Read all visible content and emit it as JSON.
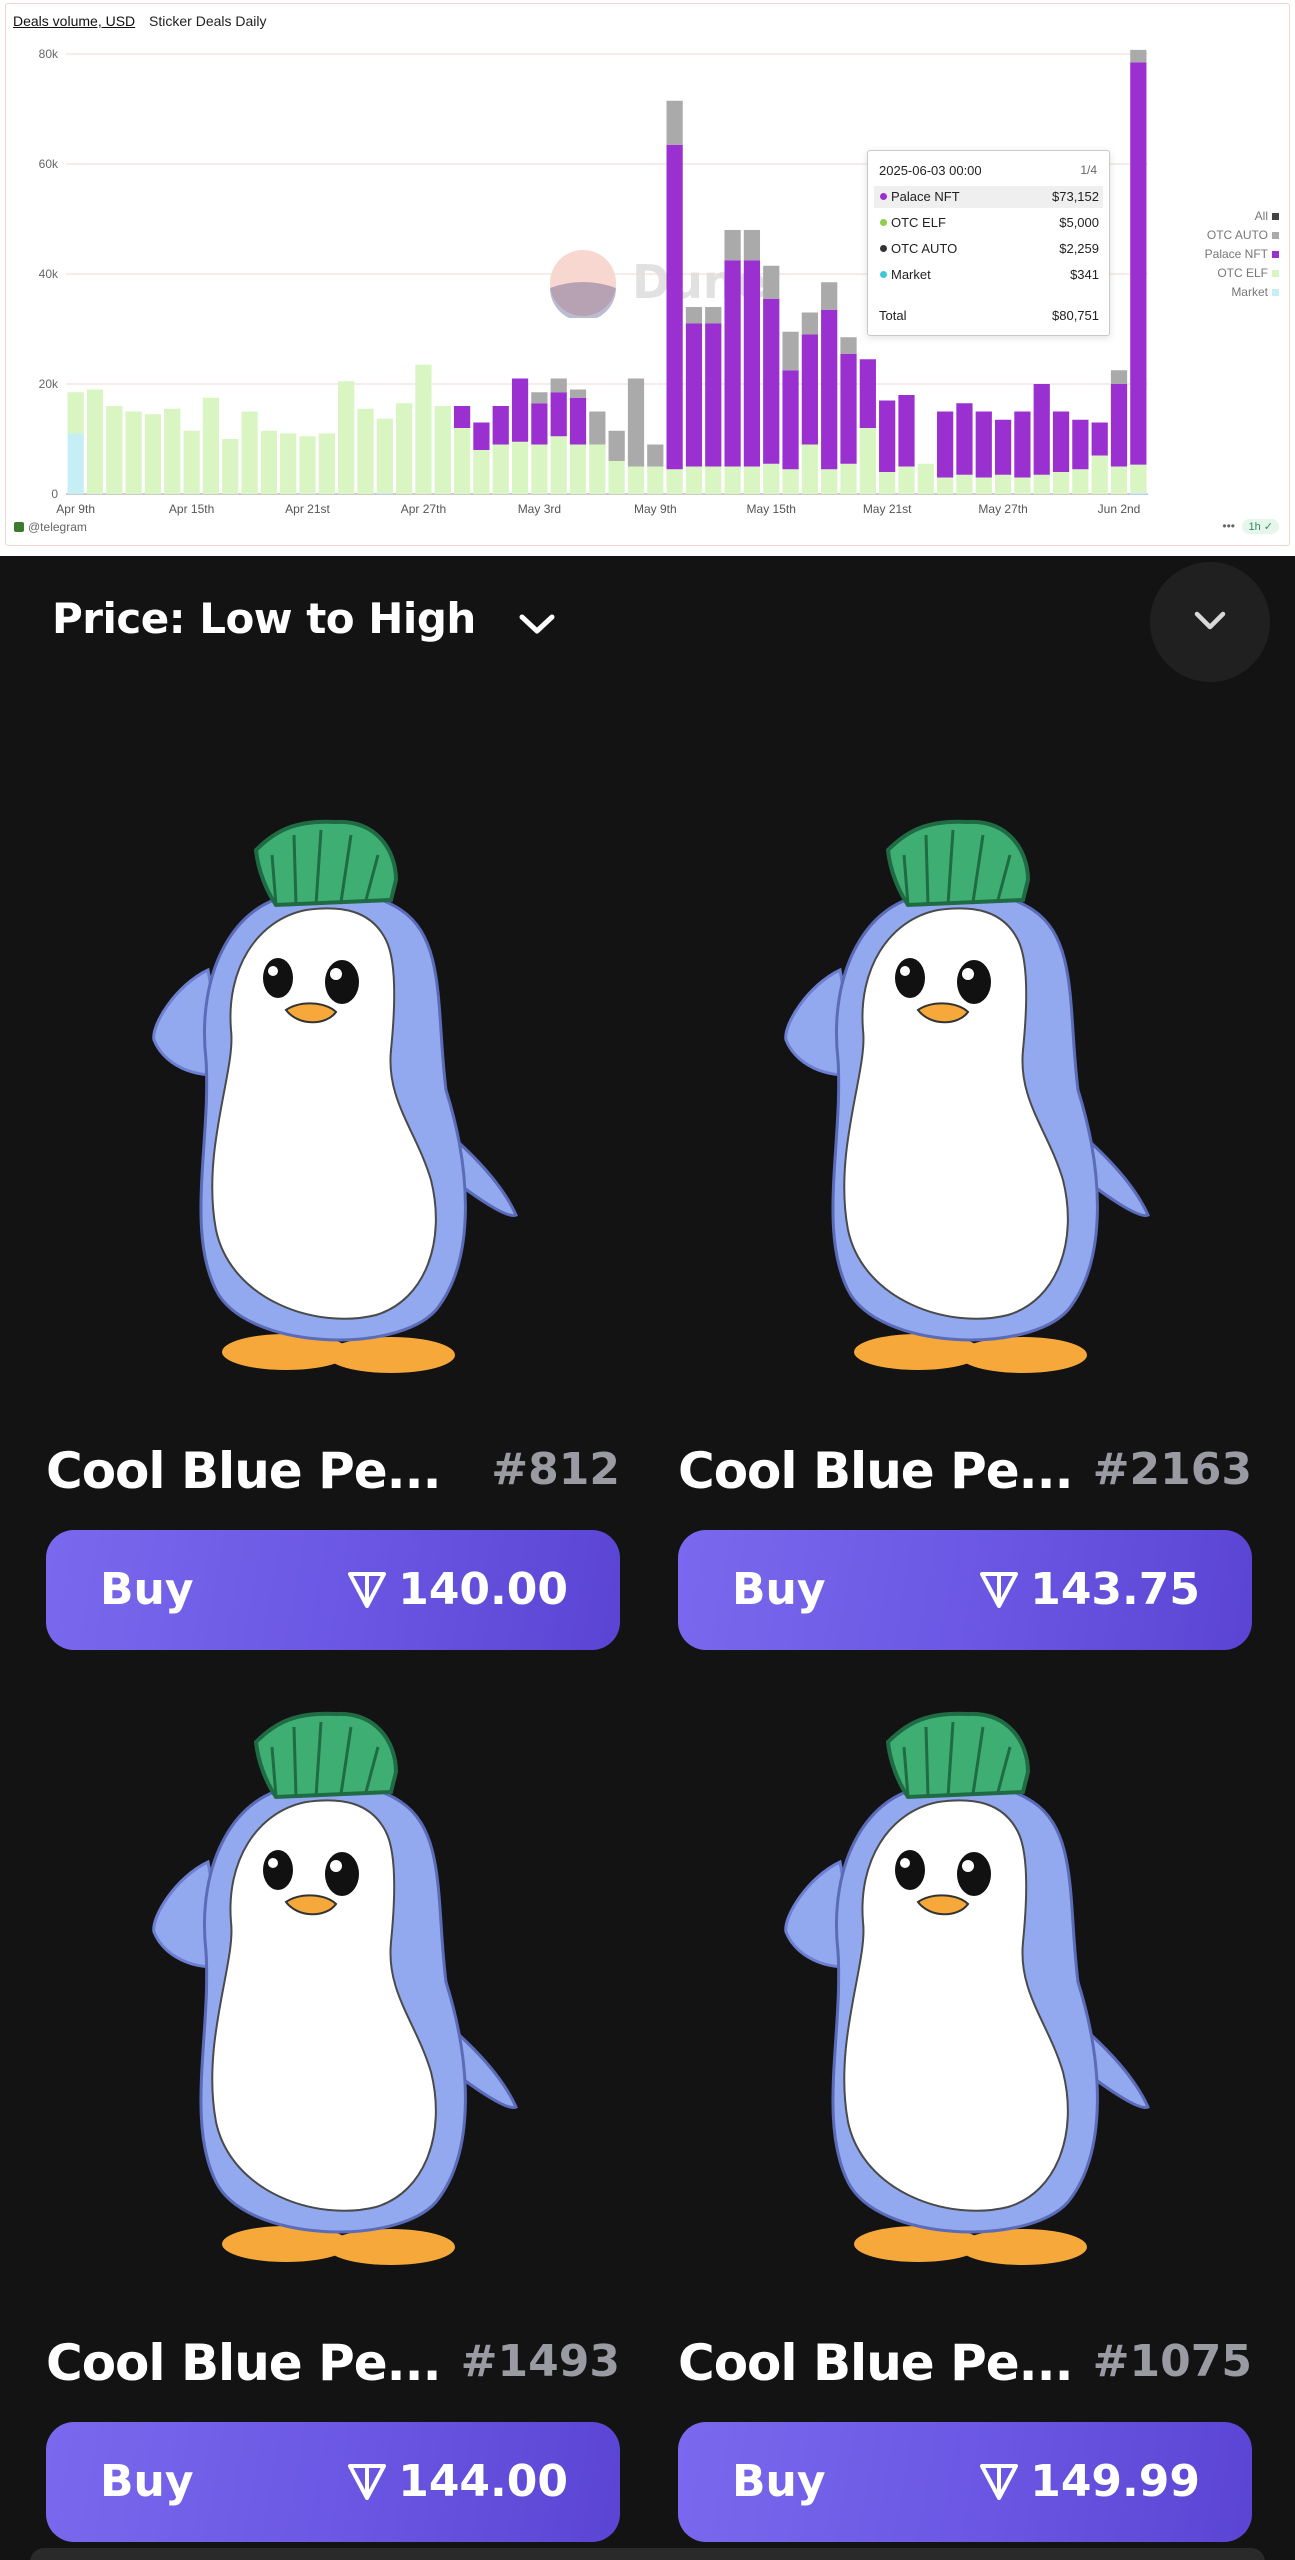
{
  "chart_panel": {
    "tabs": [
      "Deals volume, USD",
      "Sticker Deals Daily"
    ],
    "footer_source": "@telegram",
    "footer_more": "•••",
    "footer_refresh": "1h",
    "watermark": "Dune",
    "tooltip": {
      "date": "2025-06-03 00:00",
      "page": "1/4",
      "rows": [
        {
          "name": "Palace NFT",
          "value": "$73,152",
          "color": "#9b30d0"
        },
        {
          "name": "OTC ELF",
          "value": "$5,000",
          "color": "#8fce4a"
        },
        {
          "name": "OTC AUTO",
          "value": "$2,259",
          "color": "#333333"
        },
        {
          "name": "Market",
          "value": "$341",
          "color": "#3fc7d6"
        }
      ],
      "total_label": "Total",
      "total_value": "$80,751"
    },
    "legend": [
      {
        "name": "All",
        "color": "#444444"
      },
      {
        "name": "OTC AUTO",
        "color": "#aaaaaa"
      },
      {
        "name": "Palace NFT",
        "color": "#9b30d0"
      },
      {
        "name": "OTC ELF",
        "color": "#d8f5c2"
      },
      {
        "name": "Market",
        "color": "#c6eef5"
      }
    ]
  },
  "chart_data": {
    "type": "bar",
    "stacked": true,
    "title": "Deals volume, USD",
    "ylim": [
      0,
      80000
    ],
    "y_ticks": [
      "0",
      "20k",
      "40k",
      "60k",
      "80k"
    ],
    "x_tick_labels": [
      "Apr 9th",
      "Apr 15th",
      "Apr 21st",
      "Apr 27th",
      "May 3rd",
      "May 9th",
      "May 15th",
      "May 21st",
      "May 27th",
      "Jun 2nd"
    ],
    "x_tick_index": [
      0,
      6,
      12,
      18,
      24,
      30,
      36,
      42,
      48,
      54
    ],
    "grid": true,
    "legend_position": "right",
    "series": [
      {
        "name": "Market",
        "color": "#c6eef5",
        "values": [
          11000,
          0,
          0,
          0,
          0,
          0,
          0,
          0,
          0,
          0,
          0,
          0,
          0,
          0,
          0,
          0,
          200,
          0,
          0,
          0,
          0,
          0,
          0,
          0,
          0,
          0,
          0,
          0,
          0,
          0,
          0,
          0,
          0,
          0,
          0,
          0,
          0,
          0,
          0,
          0,
          0,
          0,
          0,
          0,
          0,
          0,
          0,
          0,
          0,
          0,
          0,
          0,
          0,
          0,
          0,
          341
        ]
      },
      {
        "name": "OTC ELF",
        "color": "#d8f5c2",
        "values": [
          7500,
          19000,
          16000,
          15000,
          14500,
          15500,
          11500,
          17500,
          10000,
          15000,
          11500,
          11000,
          10500,
          11000,
          20500,
          15500,
          13500,
          16500,
          23500,
          16000,
          12000,
          8000,
          9000,
          9500,
          9000,
          10500,
          9000,
          9000,
          6000,
          5000,
          5000,
          4500,
          5000,
          5000,
          5000,
          5000,
          5500,
          4500,
          9000,
          4500,
          5500,
          12000,
          4000,
          5000,
          5500,
          3000,
          3500,
          3000,
          3500,
          3000,
          3500,
          4000,
          4500,
          7000,
          5000,
          5000
        ]
      },
      {
        "name": "Palace NFT",
        "color": "#9b30d0",
        "values": [
          0,
          0,
          0,
          0,
          0,
          0,
          0,
          0,
          0,
          0,
          0,
          0,
          0,
          0,
          0,
          0,
          0,
          0,
          0,
          0,
          4000,
          5000,
          7000,
          11500,
          7500,
          8000,
          8500,
          0,
          0,
          0,
          0,
          59000,
          26000,
          26000,
          37500,
          37500,
          30000,
          18000,
          20000,
          29000,
          20000,
          12500,
          13000,
          13000,
          0,
          12000,
          13000,
          12000,
          10000,
          12000,
          16500,
          11000,
          9000,
          6000,
          15000,
          73152
        ]
      },
      {
        "name": "OTC AUTO",
        "color": "#aaaaaa",
        "values": [
          0,
          0,
          0,
          0,
          0,
          0,
          0,
          0,
          0,
          0,
          0,
          0,
          0,
          0,
          0,
          0,
          0,
          0,
          0,
          0,
          0,
          0,
          0,
          0,
          2000,
          2500,
          1500,
          6000,
          5500,
          16000,
          4000,
          8000,
          3000,
          3000,
          5500,
          5500,
          6000,
          7000,
          4000,
          5000,
          3000,
          0,
          0,
          0,
          0,
          0,
          0,
          0,
          0,
          0,
          0,
          0,
          0,
          0,
          2500,
          2259
        ]
      }
    ]
  },
  "sort": {
    "label": "Price: Low to High"
  },
  "cards": [
    {
      "title": "Cool Blue Pe...",
      "number": "#812",
      "buy_label": "Buy",
      "price": "140.00"
    },
    {
      "title": "Cool Blue Pe...",
      "number": "#2163",
      "buy_label": "Buy",
      "price": "143.75"
    },
    {
      "title": "Cool Blue Pe...",
      "number": "#1493",
      "buy_label": "Buy",
      "price": "144.00"
    },
    {
      "title": "Cool Blue Pe...",
      "number": "#1075",
      "buy_label": "Buy",
      "price": "149.99"
    }
  ]
}
